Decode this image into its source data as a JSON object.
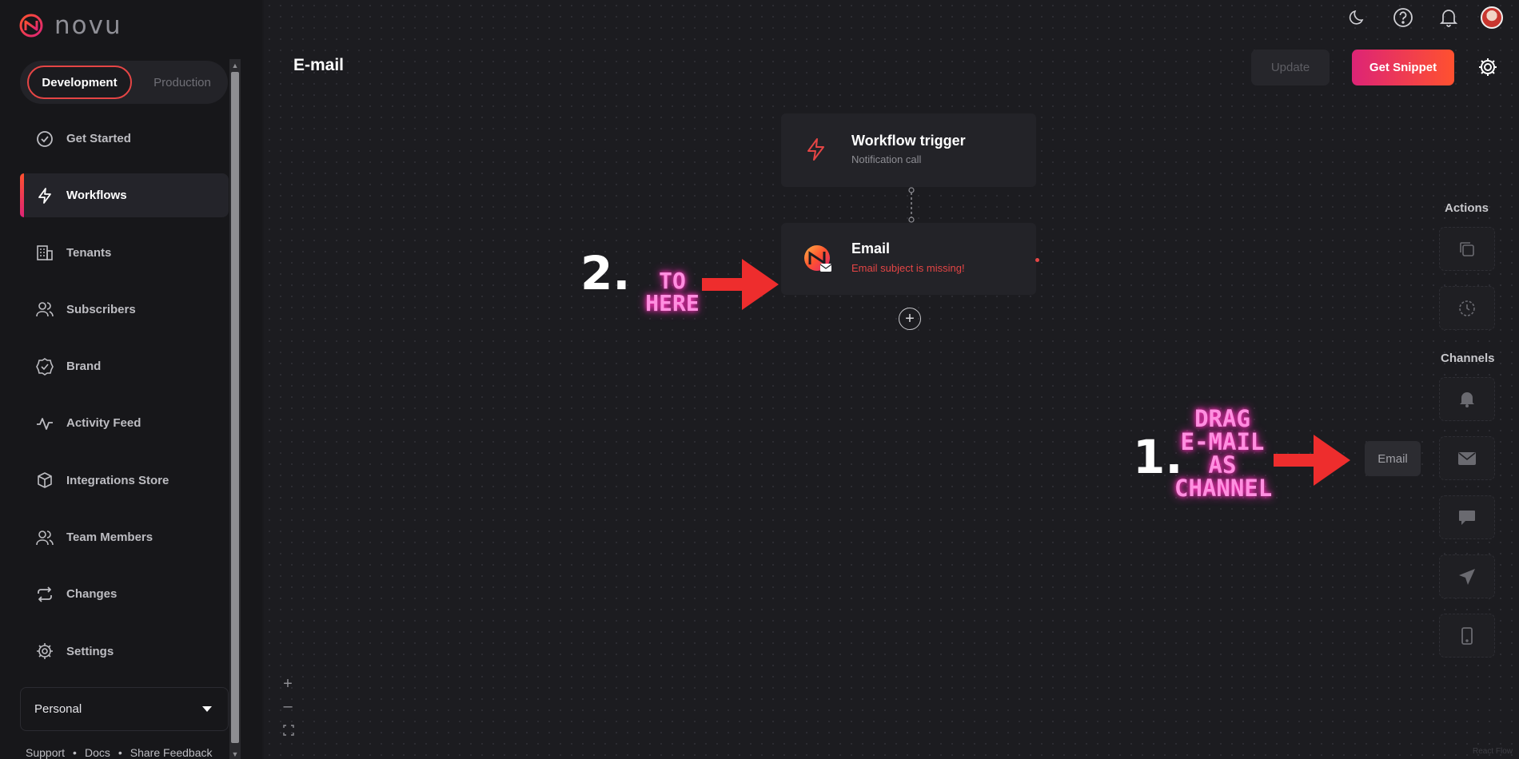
{
  "app": {
    "logo_text": "novu"
  },
  "environment": {
    "active": "Development",
    "inactive": "Production"
  },
  "sidebar": {
    "items": [
      {
        "label": "Get Started",
        "icon": "check-circle-icon"
      },
      {
        "label": "Workflows",
        "icon": "bolt-icon"
      },
      {
        "label": "Tenants",
        "icon": "building-icon"
      },
      {
        "label": "Subscribers",
        "icon": "users-icon"
      },
      {
        "label": "Brand",
        "icon": "badge-check-icon"
      },
      {
        "label": "Activity Feed",
        "icon": "activity-icon"
      },
      {
        "label": "Integrations Store",
        "icon": "cube-icon"
      },
      {
        "label": "Team Members",
        "icon": "users-icon"
      },
      {
        "label": "Changes",
        "icon": "repeat-icon"
      },
      {
        "label": "Settings",
        "icon": "gear-icon"
      }
    ],
    "active_item": "Workflows",
    "org_select": "Personal",
    "footer": {
      "support": "Support",
      "docs": "Docs",
      "feedback": "Share Feedback",
      "separator": "•"
    }
  },
  "header": {
    "title": "E-mail",
    "update_label": "Update",
    "snippet_label": "Get Snippet"
  },
  "canvas": {
    "trigger_node": {
      "title": "Workflow trigger",
      "subtitle": "Notification call"
    },
    "email_node": {
      "title": "Email",
      "error": "Email subject is missing!"
    },
    "add_symbol": "+"
  },
  "right_panel": {
    "actions_label": "Actions",
    "channels_label": "Channels",
    "drag_ghost_label": "Email"
  },
  "zoom": {
    "in": "+",
    "out": "–"
  },
  "annotations": {
    "step1_number": "1.",
    "step1_text": "DRAG E-MAIL AS CHANNEL",
    "step2_number": "2.",
    "step2_text": "TO HERE"
  },
  "watermark": "React Flow",
  "colors": {
    "accent_start": "#ff512f",
    "accent_end": "#dd2476",
    "error": "#e54545",
    "annotation_pink": "#ff8fe0",
    "arrow_red": "#ee2d2d"
  }
}
